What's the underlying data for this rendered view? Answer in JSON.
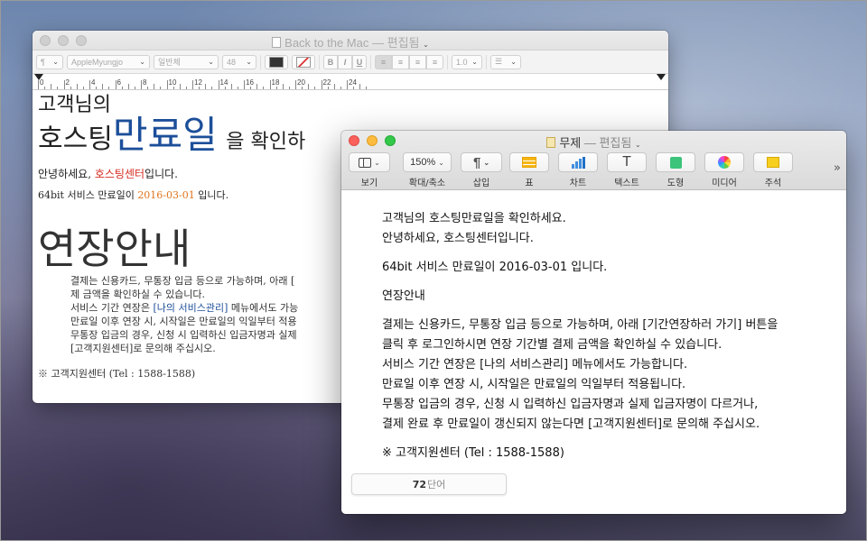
{
  "back_window": {
    "title": "Back to the Mac",
    "status": "— 편집됨",
    "format_bar": {
      "paragraph_style": "¶",
      "font_family": "AppleMyungjo",
      "font_weight": "일반체",
      "font_size": "48",
      "bold": "B",
      "italic": "I",
      "underline": "U",
      "line_spacing": "1.0"
    },
    "ruler_numbers": [
      "0",
      "2",
      "4",
      "6",
      "8",
      "10",
      "12",
      "14",
      "16",
      "18",
      "20",
      "22",
      "24"
    ],
    "doc": {
      "line1": "고객님의",
      "line2_a": "호스팅",
      "line2_b": "만료일",
      "line2_c": "을 확인하",
      "greet_a": "안녕하세요, ",
      "greet_b": "호스팅센터",
      "greet_c": "입니다.",
      "exp_a": "64bit 서비스 만료일이 ",
      "exp_b": "2016-03-01",
      "exp_c": " 입니다.",
      "heading": "연장안내",
      "p1": "결제는 신용카드, 무통장 입금 등으로 가능하며, 아래 [",
      "p2": "제 금액을 확인하실 수 있습니다.",
      "p3_a": "서비스 기간 연장은 ",
      "p3_b": "[나의 서비스관리]",
      "p3_c": " 메뉴에서도 가능",
      "p4": "만료일 이후 연장 시, 시작일은 만료일의 익일부터 적용",
      "p5": "무통장 입금의 경우, 신청 시 입력하신 입금자명과 실제",
      "p6": "[고객지원센터]로 문의해 주십시오.",
      "footer": "※ 고객지원센터 (Tel : 1588-1588)"
    }
  },
  "front_window": {
    "title": "무제",
    "status": "— 편집됨",
    "toolbar": {
      "view_label": "보기",
      "zoom_value": "150%",
      "zoom_label": "확대/축소",
      "insert_label": "삽입",
      "table_label": "표",
      "chart_label": "차트",
      "text_label": "텍스트",
      "shape_label": "도형",
      "media_label": "미디어",
      "comment_label": "주석",
      "overflow": "»"
    },
    "doc": {
      "l1": "고객님의 호스팅만료일을 확인하세요.",
      "l2": "안녕하세요, 호스팅센터입니다.",
      "l3": "64bit 서비스 만료일이 2016-03-01 입니다.",
      "l4": "연장안내",
      "l5": "결제는 신용카드, 무통장 입금 등으로 가능하며, 아래 [기간연장하러 가기] 버튼을",
      "l6": " 클릭 후 로그인하시면 연장 기간별 결제 금액을 확인하실 수 있습니다.",
      "l7": "서비스 기간 연장은 [나의 서비스관리] 메뉴에서도 가능합니다.",
      "l8": "만료일 이후 연장 시, 시작일은 만료일의 익일부터 적용됩니다.",
      "l9": "무통장 입금의 경우, 신청 시 입력하신 입금자명과 실제 입금자명이 다르거나,",
      "l10": "결제 완료 후 만료일이 갱신되지 않는다면 [고객지원센터]로 문의해 주십시오.",
      "l11": "※ 고객지원센터 (Tel : 1588-1588)"
    },
    "word_count": {
      "value": "72",
      "unit": "단어"
    }
  },
  "colors": {
    "highlight_blue": "#1c4f9a",
    "highlight_red": "#d62b20",
    "highlight_orange": "#e0731b"
  }
}
